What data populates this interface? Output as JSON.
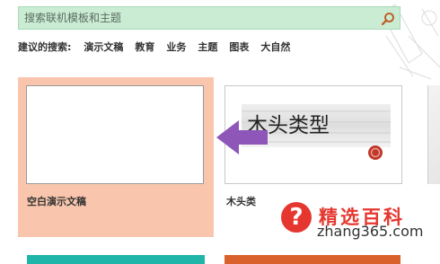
{
  "search": {
    "placeholder": "搜索联机模板和主题",
    "icon": "search-icon"
  },
  "suggestions": {
    "label": "建议的搜索:",
    "items": [
      "演示文稿",
      "教育",
      "业务",
      "主题",
      "图表",
      "大自然"
    ]
  },
  "templates": [
    {
      "title": "空白演示文稿",
      "selected": true
    },
    {
      "title": "木头类",
      "thumbnail_text": "木头类型",
      "selected": false
    }
  ],
  "watermark": {
    "symbol": "?",
    "title": "精选百科",
    "url": "zhang365.com"
  },
  "colors": {
    "search_bg": "#c9ecd3",
    "selected_card": "#f9c6ad",
    "arrow": "#8e56b8",
    "watermark_red": "#e5372f",
    "strip_teal": "#1fb5a9",
    "strip_orange": "#d9612c"
  }
}
